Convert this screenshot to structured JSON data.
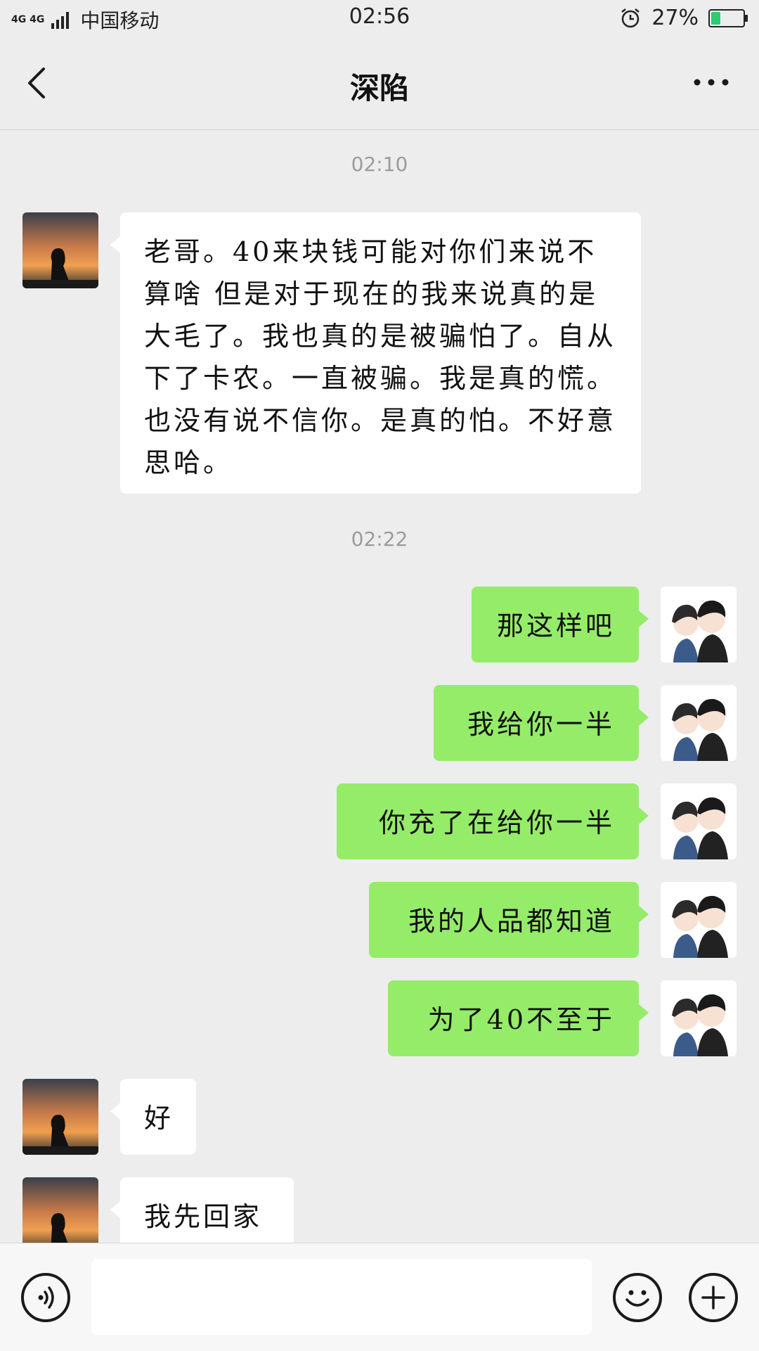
{
  "status_bar": {
    "network_label": "4G 4G",
    "carrier": "中国移动",
    "time": "02:56",
    "battery_percent": "27%",
    "battery_level": 0.27,
    "alarm_icon": "alarm-clock-icon",
    "battery_icon": "battery-charging-icon"
  },
  "header": {
    "title": "深陷",
    "back_icon": "chevron-left-icon",
    "more_icon": "ellipsis-icon"
  },
  "messages": {
    "timestamp_1": "02:10",
    "msg_1": "老哥。40来块钱可能对你们来说不算啥 但是对于现在的我来说真的是大毛了。我也真的是被骗怕了。自从下了卡农。一直被骗。我是真的慌。也没有说不信你。是真的怕。不好意思哈。",
    "timestamp_2": "02:22",
    "msg_2": "那这样吧",
    "msg_3": "我给你一半",
    "msg_4": "你充了在给你一半",
    "msg_5": "我的人品都知道",
    "msg_6": "为了40不至于",
    "msg_7": "好",
    "msg_8": "我先回家"
  },
  "input_bar": {
    "voice_icon": "voice-icon",
    "text_value": "",
    "emoji_icon": "emoji-icon",
    "add_icon": "plus-icon"
  },
  "colors": {
    "background": "#ededed",
    "outgoing_bubble": "#95ec69",
    "incoming_bubble": "#ffffff",
    "battery_fill": "#2ecc71"
  }
}
